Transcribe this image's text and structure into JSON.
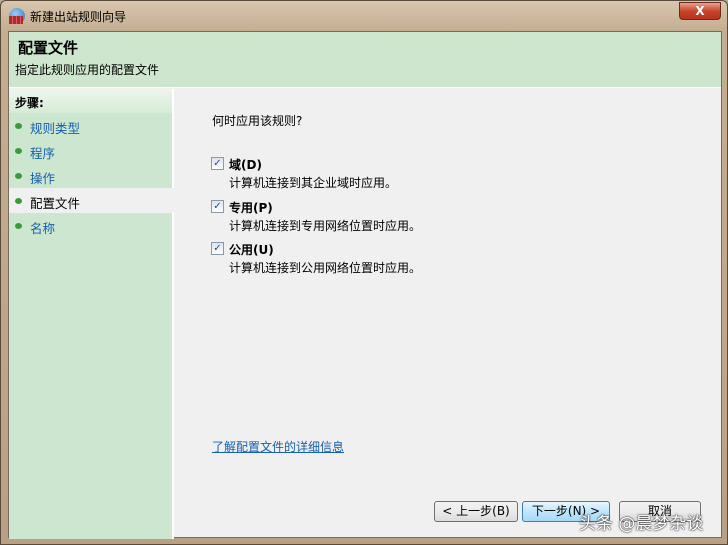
{
  "window": {
    "title": "新建出站规则向导",
    "close": "X"
  },
  "header": {
    "title": "配置文件",
    "subtitle": "指定此规则应用的配置文件"
  },
  "sidebar": {
    "heading": "步骤:",
    "items": [
      {
        "label": "规则类型"
      },
      {
        "label": "程序"
      },
      {
        "label": "操作"
      },
      {
        "label": "配置文件"
      },
      {
        "label": "名称"
      }
    ]
  },
  "main": {
    "question": "何时应用该规则?",
    "options": [
      {
        "label": "域(D)",
        "desc": "计算机连接到其企业域时应用。",
        "checked": true
      },
      {
        "label": "专用(P)",
        "desc": "计算机连接到专用网络位置时应用。",
        "checked": true
      },
      {
        "label": "公用(U)",
        "desc": "计算机连接到公用网络位置时应用。",
        "checked": true
      }
    ],
    "link": "了解配置文件的详细信息"
  },
  "buttons": {
    "back": "< 上一步(B)",
    "next": "下一步(N) >",
    "cancel": "取消"
  },
  "watermark": "头条 @晨梦杂谈"
}
